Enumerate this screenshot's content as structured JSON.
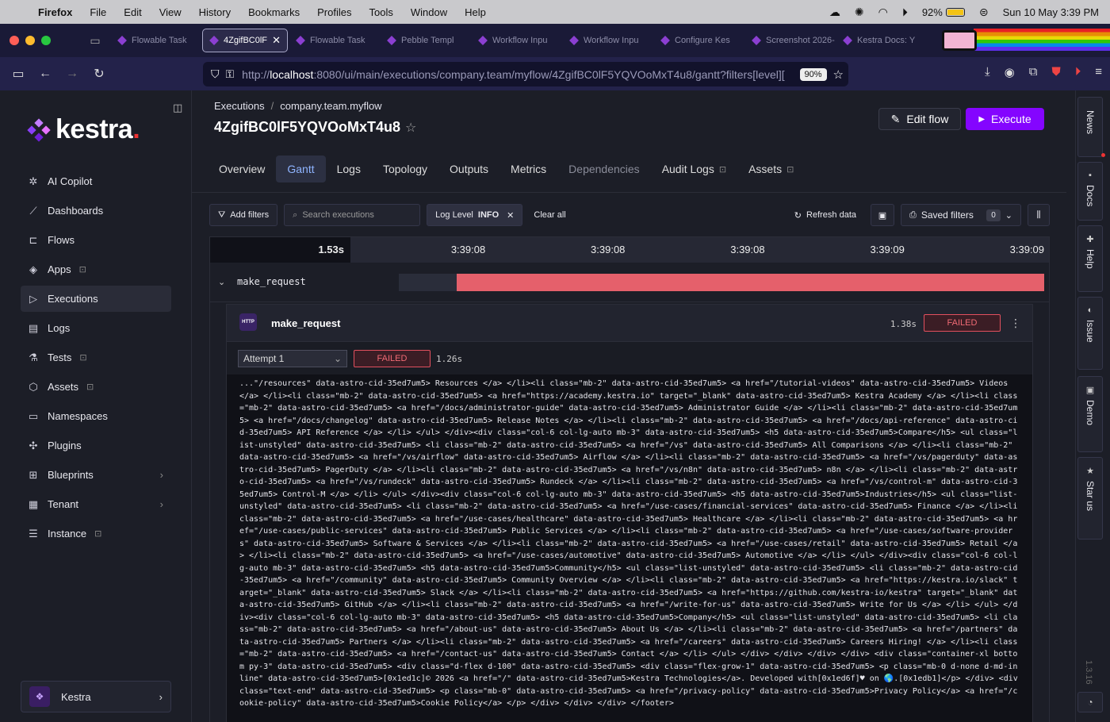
{
  "menubar": {
    "apple": "",
    "items": [
      "Firefox",
      "File",
      "Edit",
      "View",
      "History",
      "Bookmarks",
      "Profiles",
      "Tools",
      "Window",
      "Help"
    ],
    "battery": "92%",
    "datetime": "Sun 10 May  3:39 PM"
  },
  "browser": {
    "tabs": [
      {
        "label": "Flowable Task",
        "active": false
      },
      {
        "label": "4ZgifBC0lF",
        "active": true
      },
      {
        "label": "Flowable Task",
        "active": false
      },
      {
        "label": "Pebble Templ",
        "active": false
      },
      {
        "label": "Workflow Inpu",
        "active": false
      },
      {
        "label": "Workflow Inpu",
        "active": false
      },
      {
        "label": "Configure Kes",
        "active": false
      },
      {
        "label": "Screenshot 2026-",
        "active": false
      },
      {
        "label": "Kestra Docs: Y",
        "active": false
      }
    ],
    "url_prefix": "http://",
    "url_host": "localhost",
    "url_rest": ":8080/ui/main/executions/company.team/myflow/4ZgifBC0lF5YQVOoMxT4u8/gantt?filters[level][",
    "zoom": "90%"
  },
  "sidebar": {
    "logo": "kestra",
    "items": [
      {
        "label": "AI Copilot",
        "icon": "sparkle-icon",
        "glyph": "✲",
        "locked": false,
        "chevron": false,
        "active": false
      },
      {
        "label": "Dashboards",
        "icon": "chart-line-icon",
        "glyph": "⟋",
        "locked": false,
        "chevron": false,
        "active": false
      },
      {
        "label": "Flows",
        "icon": "flow-icon",
        "glyph": "⊏",
        "locked": false,
        "chevron": false,
        "active": false
      },
      {
        "label": "Apps",
        "icon": "layers-icon",
        "glyph": "◈",
        "locked": true,
        "chevron": false,
        "active": false
      },
      {
        "label": "Executions",
        "icon": "play-icon",
        "glyph": "▷",
        "locked": false,
        "chevron": false,
        "active": true
      },
      {
        "label": "Logs",
        "icon": "file-icon",
        "glyph": "▤",
        "locked": false,
        "chevron": false,
        "active": false
      },
      {
        "label": "Tests",
        "icon": "flask-icon",
        "glyph": "⚗",
        "locked": true,
        "chevron": false,
        "active": false
      },
      {
        "label": "Assets",
        "icon": "cube-icon",
        "glyph": "⬡",
        "locked": true,
        "chevron": false,
        "active": false
      },
      {
        "label": "Namespaces",
        "icon": "folder-icon",
        "glyph": "▭",
        "locked": false,
        "chevron": false,
        "active": false
      },
      {
        "label": "Plugins",
        "icon": "puzzle-icon",
        "glyph": "✣",
        "locked": false,
        "chevron": false,
        "active": false
      },
      {
        "label": "Blueprints",
        "icon": "blueprint-icon",
        "glyph": "⊞",
        "locked": false,
        "chevron": true,
        "active": false
      },
      {
        "label": "Tenant",
        "icon": "building-icon",
        "glyph": "▦",
        "locked": false,
        "chevron": true,
        "active": false
      },
      {
        "label": "Instance",
        "icon": "server-icon",
        "glyph": "☰",
        "locked": true,
        "chevron": false,
        "active": false
      }
    ],
    "tenant": "Kestra"
  },
  "header": {
    "breadcrumb": [
      "Executions",
      "company.team.myflow"
    ],
    "execution_id": "4ZgifBC0lF5YQVOoMxT4u8",
    "edit_label": "Edit flow",
    "execute_label": "Execute"
  },
  "tabs": [
    {
      "label": "Overview",
      "active": false,
      "dim": false,
      "locked": false
    },
    {
      "label": "Gantt",
      "active": true,
      "dim": false,
      "locked": false
    },
    {
      "label": "Logs",
      "active": false,
      "dim": false,
      "locked": false
    },
    {
      "label": "Topology",
      "active": false,
      "dim": false,
      "locked": false
    },
    {
      "label": "Outputs",
      "active": false,
      "dim": false,
      "locked": false
    },
    {
      "label": "Metrics",
      "active": false,
      "dim": false,
      "locked": false
    },
    {
      "label": "Dependencies",
      "active": false,
      "dim": true,
      "locked": false
    },
    {
      "label": "Audit Logs",
      "active": false,
      "dim": false,
      "locked": true
    },
    {
      "label": "Assets",
      "active": false,
      "dim": false,
      "locked": true
    }
  ],
  "filters": {
    "add_label": "Add filters",
    "search_placeholder": "Search executions",
    "chip_key": "Log Level",
    "chip_value": "INFO",
    "clear_label": "Clear all",
    "refresh_label": "Refresh data",
    "saved_label": "Saved filters",
    "saved_count": "0"
  },
  "gantt": {
    "total_duration": "1.53s",
    "ticks": [
      "3:39:08",
      "3:39:08",
      "3:39:08",
      "3:39:09",
      "3:39:09"
    ],
    "task_name": "make_request",
    "bar_start": 0.09,
    "bar_end": 1.0
  },
  "task_detail": {
    "icon_text": "HTTP",
    "title": "make_request",
    "duration": "1.38s",
    "status": "FAILED",
    "attempt_label": "Attempt 1",
    "attempt_status": "FAILED",
    "attempt_duration": "1.26s"
  },
  "log_text": "...\"/resources\" data-astro-cid-35ed7um5> Resources </a> </li><li class=\"mb-2\" data-astro-cid-35ed7um5> <a href=\"/tutorial-videos\" data-astro-cid-35ed7um5> Videos </a> </li><li class=\"mb-2\" data-astro-cid-35ed7um5> <a href=\"https://academy.kestra.io\" target=\"_blank\" data-astro-cid-35ed7um5> Kestra Academy </a> </li><li class=\"mb-2\" data-astro-cid-35ed7um5> <a href=\"/docs/administrator-guide\" data-astro-cid-35ed7um5> Administrator Guide </a> </li><li class=\"mb-2\" data-astro-cid-35ed7um5> <a href=\"/docs/changelog\" data-astro-cid-35ed7um5> Release Notes </a> </li><li class=\"mb-2\" data-astro-cid-35ed7um5> <a href=\"/docs/api-reference\" data-astro-cid-35ed7um5> API Reference </a> </li> </ul> </div><div class=\"col-6 col-lg-auto mb-3\" data-astro-cid-35ed7um5> <h5 data-astro-cid-35ed7um5>Compare</h5> <ul class=\"list-unstyled\" data-astro-cid-35ed7um5> <li class=\"mb-2\" data-astro-cid-35ed7um5> <a href=\"/vs\" data-astro-cid-35ed7um5> All Comparisons </a> </li><li class=\"mb-2\" data-astro-cid-35ed7um5> <a href=\"/vs/airflow\" data-astro-cid-35ed7um5> Airflow </a> </li><li class=\"mb-2\" data-astro-cid-35ed7um5> <a href=\"/vs/pagerduty\" data-astro-cid-35ed7um5> PagerDuty </a> </li><li class=\"mb-2\" data-astro-cid-35ed7um5> <a href=\"/vs/n8n\" data-astro-cid-35ed7um5> n8n </a> </li><li class=\"mb-2\" data-astro-cid-35ed7um5> <a href=\"/vs/rundeck\" data-astro-cid-35ed7um5> Rundeck </a> </li><li class=\"mb-2\" data-astro-cid-35ed7um5> <a href=\"/vs/control-m\" data-astro-cid-35ed7um5> Control-M </a> </li> </ul> </div><div class=\"col-6 col-lg-auto mb-3\" data-astro-cid-35ed7um5> <h5 data-astro-cid-35ed7um5>Industries</h5> <ul class=\"list-unstyled\" data-astro-cid-35ed7um5> <li class=\"mb-2\" data-astro-cid-35ed7um5> <a href=\"/use-cases/financial-services\" data-astro-cid-35ed7um5> Finance </a> </li><li class=\"mb-2\" data-astro-cid-35ed7um5> <a href=\"/use-cases/healthcare\" data-astro-cid-35ed7um5> Healthcare </a> </li><li class=\"mb-2\" data-astro-cid-35ed7um5> <a href=\"/use-cases/public-services\" data-astro-cid-35ed7um5> Public Services </a> </li><li class=\"mb-2\" data-astro-cid-35ed7um5> <a href=\"/use-cases/software-providers\" data-astro-cid-35ed7um5> Software & Services </a> </li><li class=\"mb-2\" data-astro-cid-35ed7um5> <a href=\"/use-cases/retail\" data-astro-cid-35ed7um5> Retail </a> </li><li class=\"mb-2\" data-astro-cid-35ed7um5> <a href=\"/use-cases/automotive\" data-astro-cid-35ed7um5> Automotive </a> </li> </ul> </div><div class=\"col-6 col-lg-auto mb-3\" data-astro-cid-35ed7um5> <h5 data-astro-cid-35ed7um5>Community</h5> <ul class=\"list-unstyled\" data-astro-cid-35ed7um5> <li class=\"mb-2\" data-astro-cid-35ed7um5> <a href=\"/community\" data-astro-cid-35ed7um5> Community Overview </a> </li><li class=\"mb-2\" data-astro-cid-35ed7um5> <a href=\"https://kestra.io/slack\" target=\"_blank\" data-astro-cid-35ed7um5> Slack </a> </li><li class=\"mb-2\" data-astro-cid-35ed7um5> <a href=\"https://github.com/kestra-io/kestra\" target=\"_blank\" data-astro-cid-35ed7um5> GitHub </a> </li><li class=\"mb-2\" data-astro-cid-35ed7um5> <a href=\"/write-for-us\" data-astro-cid-35ed7um5> Write for Us </a> </li> </ul> </div><div class=\"col-6 col-lg-auto mb-3\" data-astro-cid-35ed7um5> <h5 data-astro-cid-35ed7um5>Company</h5> <ul class=\"list-unstyled\" data-astro-cid-35ed7um5> <li class=\"mb-2\" data-astro-cid-35ed7um5> <a href=\"/about-us\" data-astro-cid-35ed7um5> About Us </a> </li><li class=\"mb-2\" data-astro-cid-35ed7um5> <a href=\"/partners\" data-astro-cid-35ed7um5> Partners </a> </li><li class=\"mb-2\" data-astro-cid-35ed7um5> <a href=\"/careers\" data-astro-cid-35ed7um5> Careers Hiring! </a> </li><li class=\"mb-2\" data-astro-cid-35ed7um5> <a href=\"/contact-us\" data-astro-cid-35ed7um5> Contact </a> </li> </ul> </div> </div> </div> </div> <div class=\"container-xl bottom py-3\" data-astro-cid-35ed7um5> <div class=\"d-flex d-100\" data-astro-cid-35ed7um5> <div class=\"flex-grow-1\" data-astro-cid-35ed7um5> <p class=\"mb-0 d-none d-md-inline\" data-astro-cid-35ed7um5>[0x1ed1c]© 2026 <a href=\"/\" data-astro-cid-35ed7um5>Kestra Technologies</a>. Developed with[0x1ed6f]♥ on 🌎.[0x1edb1]</p> </div> <div class=\"text-end\" data-astro-cid-35ed7um5> <p class=\"mb-0\" data-astro-cid-35ed7um5> <a href=\"/privacy-policy\" data-astro-cid-35ed7um5>Privacy Policy</a> <a href=\"/cookie-policy\" data-astro-cid-35ed7um5>Cookie Policy</a> </p> </div> </div> </div> </footer>",
  "rail": {
    "items": [
      {
        "label": "News",
        "icon": "bell-icon",
        "glyph": ""
      },
      {
        "label": "Docs",
        "icon": "book-icon",
        "glyph": "▪"
      },
      {
        "label": "Help",
        "icon": "help-icon",
        "glyph": "✚"
      },
      {
        "label": "Issue",
        "icon": "github-icon",
        "glyph": "◐"
      },
      {
        "label": "Demo",
        "icon": "monitor-icon",
        "glyph": "▣"
      },
      {
        "label": "Star us",
        "icon": "star-icon",
        "glyph": "★"
      }
    ],
    "version": "1.3.16"
  }
}
